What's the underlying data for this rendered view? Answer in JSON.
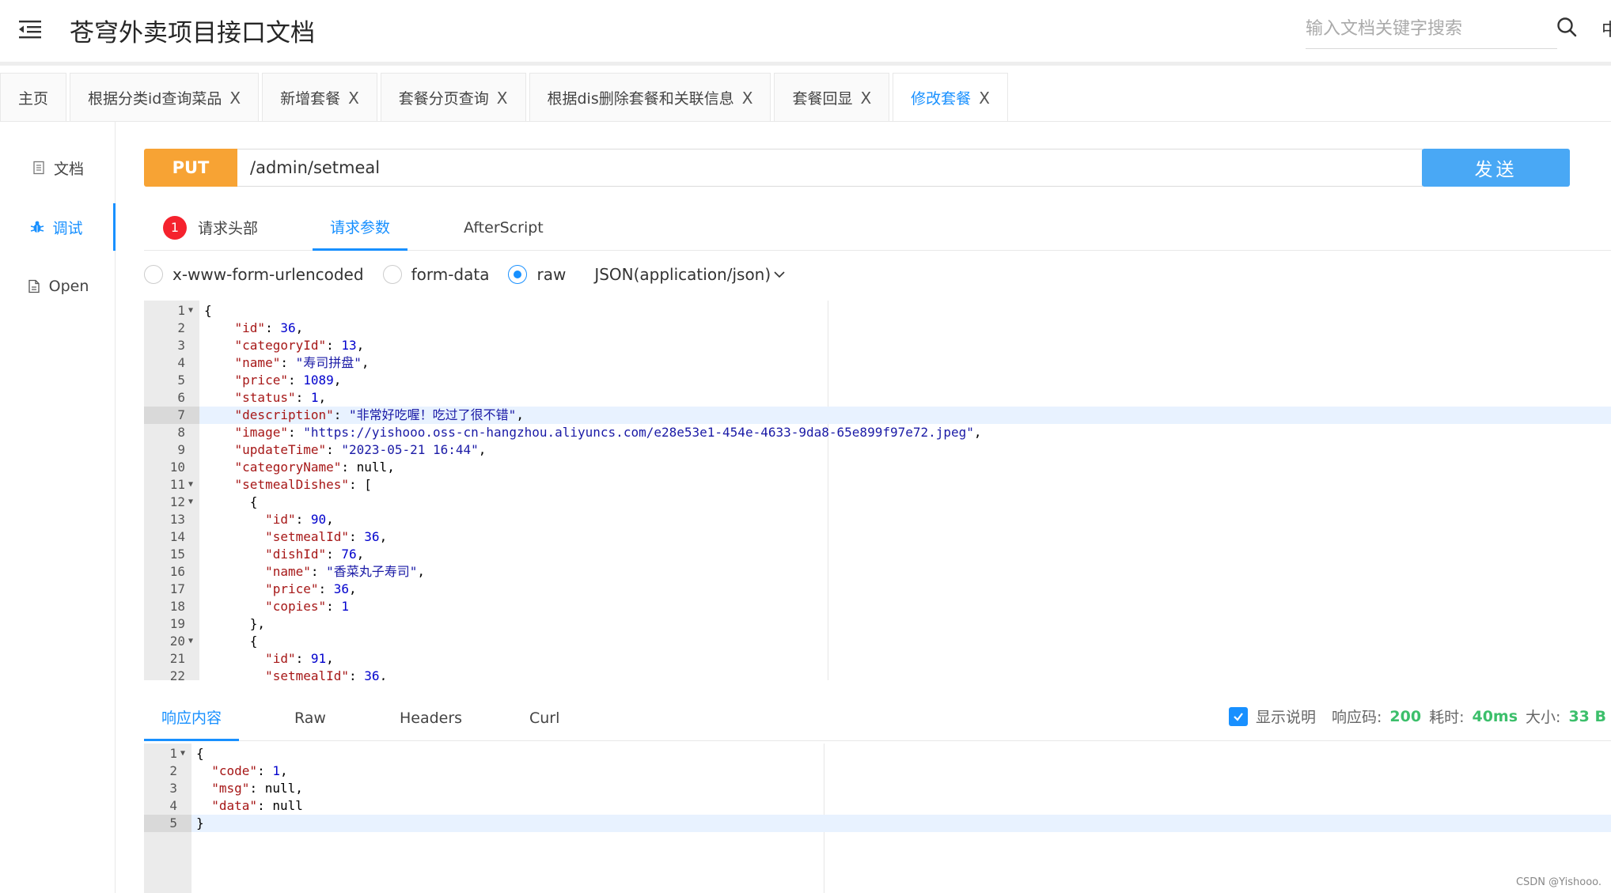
{
  "app": {
    "title": "苍穹外卖项目接口文档",
    "search_placeholder": "输入文档关键字搜索",
    "header_edge_text": "中"
  },
  "tabs": [
    {
      "label": "主页",
      "closable": false,
      "active": false
    },
    {
      "label": "根据分类id查询菜品",
      "closable": true,
      "active": false
    },
    {
      "label": "新增套餐",
      "closable": true,
      "active": false
    },
    {
      "label": "套餐分页查询",
      "closable": true,
      "active": false
    },
    {
      "label": "根据dis删除套餐和关联信息",
      "closable": true,
      "active": false
    },
    {
      "label": "套餐回显",
      "closable": true,
      "active": false
    },
    {
      "label": "修改套餐",
      "closable": true,
      "active": true
    }
  ],
  "tab_close_glyph": "X",
  "leftnav": {
    "items": [
      {
        "label": "文档",
        "icon": "document-icon",
        "active": false
      },
      {
        "label": "调试",
        "icon": "bug-icon",
        "active": true
      },
      {
        "label": "Open",
        "icon": "file-icon",
        "active": false
      }
    ]
  },
  "request": {
    "method": "PUT",
    "url": "/admin/setmeal",
    "send_label": "发送"
  },
  "request_tabs": {
    "headers_badge": "1",
    "headers_label": "请求头部",
    "params_label": "请求参数",
    "afterscript_label": "AfterScript"
  },
  "body_types": {
    "options": [
      "x-www-form-urlencoded",
      "form-data",
      "raw"
    ],
    "selected": "raw",
    "content_type": "JSON(application/json)"
  },
  "request_body_lines": [
    "{",
    "    \"id\": 36,",
    "    \"categoryId\": 13,",
    "    \"name\": \"寿司拼盘\",",
    "    \"price\": 1089,",
    "    \"status\": 1,",
    "    \"description\": \"非常好吃喔！吃过了很不错\",",
    "    \"image\": \"https://yishooo.oss-cn-hangzhou.aliyuncs.com/e28e53e1-454e-4633-9da8-65e899f97e72.jpeg\",",
    "    \"updateTime\": \"2023-05-21 16:44\",",
    "    \"categoryName\": null,",
    "    \"setmealDishes\": [",
    "      {",
    "        \"id\": 90,",
    "        \"setmealId\": 36,",
    "        \"dishId\": 76,",
    "        \"name\": \"香菜丸子寿司\",",
    "        \"price\": 36,",
    "        \"copies\": 1",
    "      },",
    "      {",
    "        \"id\": 91,",
    "        \"setmealId\": 36,"
  ],
  "request_fold_lines": [
    1,
    11,
    12,
    20
  ],
  "request_active_line": 7,
  "response_tabs": {
    "items": [
      "响应内容",
      "Raw",
      "Headers",
      "Curl"
    ],
    "active": "响应内容",
    "show_desc_label": "显示说明",
    "show_desc_checked": true,
    "status_label": "响应码:",
    "status_value": "200",
    "time_label": "耗时:",
    "time_value": "40ms",
    "size_label": "大小:",
    "size_value": "33 B"
  },
  "response_body_lines": [
    "{",
    "  \"code\": 1,",
    "  \"msg\": null,",
    "  \"data\": null",
    "}"
  ],
  "response_fold_lines": [
    1
  ],
  "response_active_line": 5,
  "watermark": "CSDN @Yishooo.",
  "colors": {
    "accent": "#1890ff",
    "method_put": "#f7a334",
    "send_button": "#49a8f5",
    "success": "#3cbf6b",
    "badge": "#f5222d"
  }
}
